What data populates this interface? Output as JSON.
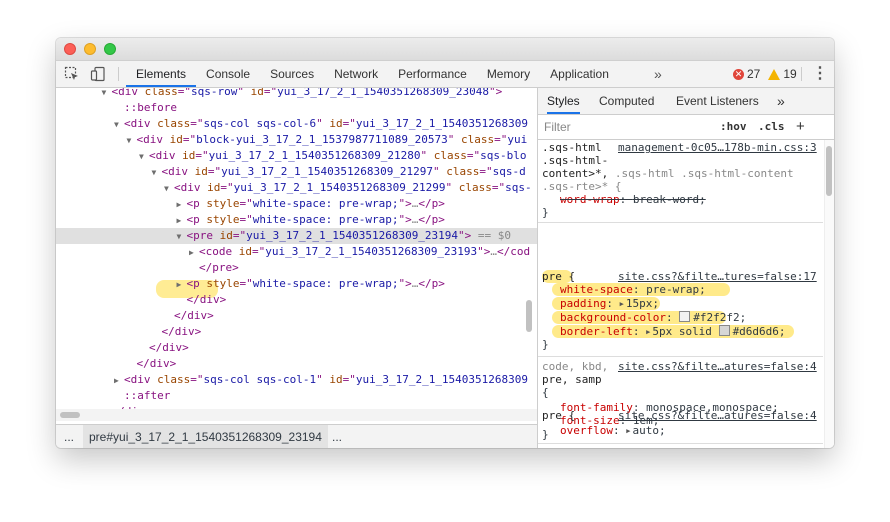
{
  "toolbar": {
    "tabs": [
      "Elements",
      "Console",
      "Sources",
      "Network",
      "Performance",
      "Memory",
      "Application"
    ],
    "more": "»",
    "errors": "27",
    "warnings": "19",
    "menu": "⋮"
  },
  "dom": [
    {
      "indent": 3,
      "tri": "▼",
      "html": [
        [
          "tag",
          "<div "
        ],
        [
          "attr",
          "class"
        ],
        [
          "tag",
          "=\""
        ],
        [
          "val",
          "sqs-row"
        ],
        [
          "tag",
          "\" "
        ],
        [
          "attr",
          "id"
        ],
        [
          "tag",
          "=\""
        ],
        [
          "val",
          "yui_3_17_2_1_1540351268309_23048"
        ],
        [
          "tag",
          "\">"
        ]
      ]
    },
    {
      "indent": 4,
      "tri": "",
      "html": [
        [
          "pseudo",
          "::before"
        ]
      ]
    },
    {
      "indent": 4,
      "tri": "▼",
      "html": [
        [
          "tag",
          "<div "
        ],
        [
          "attr",
          "class"
        ],
        [
          "tag",
          "=\""
        ],
        [
          "val",
          "sqs-col sqs-col-6"
        ],
        [
          "tag",
          "\" "
        ],
        [
          "attr",
          "id"
        ],
        [
          "tag",
          "=\""
        ],
        [
          "val",
          "yui_3_17_2_1_1540351268309"
        ]
      ]
    },
    {
      "indent": 5,
      "tri": "▼",
      "html": [
        [
          "tag",
          "<div "
        ],
        [
          "attr",
          "id"
        ],
        [
          "tag",
          "=\""
        ],
        [
          "val",
          "block-yui_3_17_2_1_1537987711089_20573"
        ],
        [
          "tag",
          "\" "
        ],
        [
          "attr",
          "class"
        ],
        [
          "tag",
          "=\""
        ],
        [
          "val",
          "yui"
        ]
      ]
    },
    {
      "indent": 6,
      "tri": "▼",
      "html": [
        [
          "tag",
          "<div "
        ],
        [
          "attr",
          "id"
        ],
        [
          "tag",
          "=\""
        ],
        [
          "val",
          "yui_3_17_2_1_1540351268309_21280"
        ],
        [
          "tag",
          "\" "
        ],
        [
          "attr",
          "class"
        ],
        [
          "tag",
          "=\""
        ],
        [
          "val",
          "sqs-blo"
        ]
      ]
    },
    {
      "indent": 7,
      "tri": "▼",
      "html": [
        [
          "tag",
          "<div "
        ],
        [
          "attr",
          "id"
        ],
        [
          "tag",
          "=\""
        ],
        [
          "val",
          "yui_3_17_2_1_1540351268309_21297"
        ],
        [
          "tag",
          "\" "
        ],
        [
          "attr",
          "class"
        ],
        [
          "tag",
          "=\""
        ],
        [
          "val",
          "sqs-d"
        ]
      ]
    },
    {
      "indent": 8,
      "tri": "▼",
      "html": [
        [
          "tag",
          "<div "
        ],
        [
          "attr",
          "id"
        ],
        [
          "tag",
          "=\""
        ],
        [
          "val",
          "yui_3_17_2_1_1540351268309_21299"
        ],
        [
          "tag",
          "\" "
        ],
        [
          "attr",
          "class"
        ],
        [
          "tag",
          "=\""
        ],
        [
          "val",
          "sqs-"
        ]
      ]
    },
    {
      "indent": 9,
      "tri": "▶",
      "html": [
        [
          "tag",
          "<p "
        ],
        [
          "attr",
          "style"
        ],
        [
          "tag",
          "=\""
        ],
        [
          "val",
          "white-space: pre-wrap;"
        ],
        [
          "tag",
          "\">"
        ],
        [
          "dim",
          "…"
        ],
        [
          "tag",
          "</p>"
        ]
      ]
    },
    {
      "indent": 9,
      "tri": "▶",
      "html": [
        [
          "tag",
          "<p "
        ],
        [
          "attr",
          "style"
        ],
        [
          "tag",
          "=\""
        ],
        [
          "val",
          "white-space: pre-wrap;"
        ],
        [
          "tag",
          "\">"
        ],
        [
          "dim",
          "…"
        ],
        [
          "tag",
          "</p>"
        ]
      ]
    },
    {
      "indent": 9,
      "tri": "▼",
      "selected": true,
      "html": [
        [
          "tag",
          "<pre "
        ],
        [
          "attr",
          "id"
        ],
        [
          "tag",
          "=\""
        ],
        [
          "val",
          "yui_3_17_2_1_1540351268309_23194"
        ],
        [
          "tag",
          "\">"
        ],
        [
          "dim",
          " == $0"
        ]
      ]
    },
    {
      "indent": 10,
      "tri": "▶",
      "html": [
        [
          "tag",
          "<code "
        ],
        [
          "attr",
          "id"
        ],
        [
          "tag",
          "=\""
        ],
        [
          "val",
          "yui_3_17_2_1_1540351268309_23193"
        ],
        [
          "tag",
          "\">"
        ],
        [
          "dim",
          "…"
        ],
        [
          "tag",
          "</cod"
        ]
      ]
    },
    {
      "indent": 10,
      "tri": "",
      "html": [
        [
          "tag",
          "</pre>"
        ]
      ]
    },
    {
      "indent": 9,
      "tri": "▶",
      "html": [
        [
          "tag",
          "<p "
        ],
        [
          "attr",
          "style"
        ],
        [
          "tag",
          "=\""
        ],
        [
          "val",
          "white-space: pre-wrap;"
        ],
        [
          "tag",
          "\">"
        ],
        [
          "dim",
          "…"
        ],
        [
          "tag",
          "</p>"
        ]
      ]
    },
    {
      "indent": 9,
      "tri": "",
      "html": [
        [
          "tag",
          "</div>"
        ]
      ]
    },
    {
      "indent": 8,
      "tri": "",
      "html": [
        [
          "tag",
          "</div>"
        ]
      ]
    },
    {
      "indent": 7,
      "tri": "",
      "html": [
        [
          "tag",
          "</div>"
        ]
      ]
    },
    {
      "indent": 6,
      "tri": "",
      "html": [
        [
          "tag",
          "</div>"
        ]
      ]
    },
    {
      "indent": 5,
      "tri": "",
      "html": [
        [
          "tag",
          "</div>"
        ]
      ]
    },
    {
      "indent": 4,
      "tri": "▶",
      "html": [
        [
          "tag",
          "<div "
        ],
        [
          "attr",
          "class"
        ],
        [
          "tag",
          "=\""
        ],
        [
          "val",
          "sqs-col sqs-col-1"
        ],
        [
          "tag",
          "\" "
        ],
        [
          "attr",
          "id"
        ],
        [
          "tag",
          "=\""
        ],
        [
          "val",
          "yui_3_17_2_1_1540351268309"
        ]
      ]
    },
    {
      "indent": 4,
      "tri": "",
      "html": [
        [
          "pseudo",
          "::after"
        ]
      ]
    },
    {
      "indent": 3,
      "tri": "",
      "html": [
        [
          "tag",
          "</div>"
        ]
      ]
    }
  ],
  "breadcrumb": {
    "left_more": "...",
    "selected": "pre#yui_3_17_2_1_1540351268309_23194",
    "right_more": "..."
  },
  "sidebar": {
    "tabs": [
      "Styles",
      "Computed",
      "Event Listeners"
    ],
    "more": "»",
    "filter_placeholder": "Filter",
    "hov": ":hov",
    "cls": ".cls",
    "plus": "+"
  },
  "styles": {
    "rule1": {
      "selector_line1": ".sqs-html",
      "selector_line2": ".sqs-html-",
      "selector_line3a": "content>*,",
      "selector_line3b": " .sqs-html .sqs-html-content",
      "selector_line4": ".sqs-rte>* {",
      "source": "management-0c05…178b-min.css:3",
      "prop": "word-wrap",
      "value": "break-word;",
      "close": "}"
    },
    "rule2": {
      "selector": "pre {",
      "source": "site.css?&filte…tures=false:17",
      "props": [
        {
          "name": "white-space",
          "value": "pre-wrap;"
        },
        {
          "name": "padding",
          "value": "15px;",
          "arrow": true
        },
        {
          "name": "background-color",
          "value": "#f2f2f2;",
          "swatch": "#f2f2f2"
        },
        {
          "name": "border-left",
          "value": "5px solid ",
          "arrow": true,
          "swatch": "#d6d6d6",
          "value2": "#d6d6d6;"
        }
      ],
      "close": "}"
    },
    "rule3": {
      "selector_dim": "code, kbd,",
      "selector2": "pre, samp",
      "open": "{",
      "source": "site.css?&filte…atures=false:4",
      "props": [
        {
          "name": "font-family",
          "value": "monospace,monospace;"
        },
        {
          "name": "font-size",
          "value": "1em;"
        }
      ],
      "close": "}"
    },
    "rule4": {
      "selector": "pre {",
      "source": "site.css?&filte…atures=false:4",
      "props": [
        {
          "name": "overflow",
          "value": "auto;",
          "arrow": true
        }
      ],
      "close": "}"
    }
  },
  "colors": {
    "accent": "#1a73e8",
    "highlight": "#ffdc3c",
    "selection": "#e0e0e0"
  }
}
